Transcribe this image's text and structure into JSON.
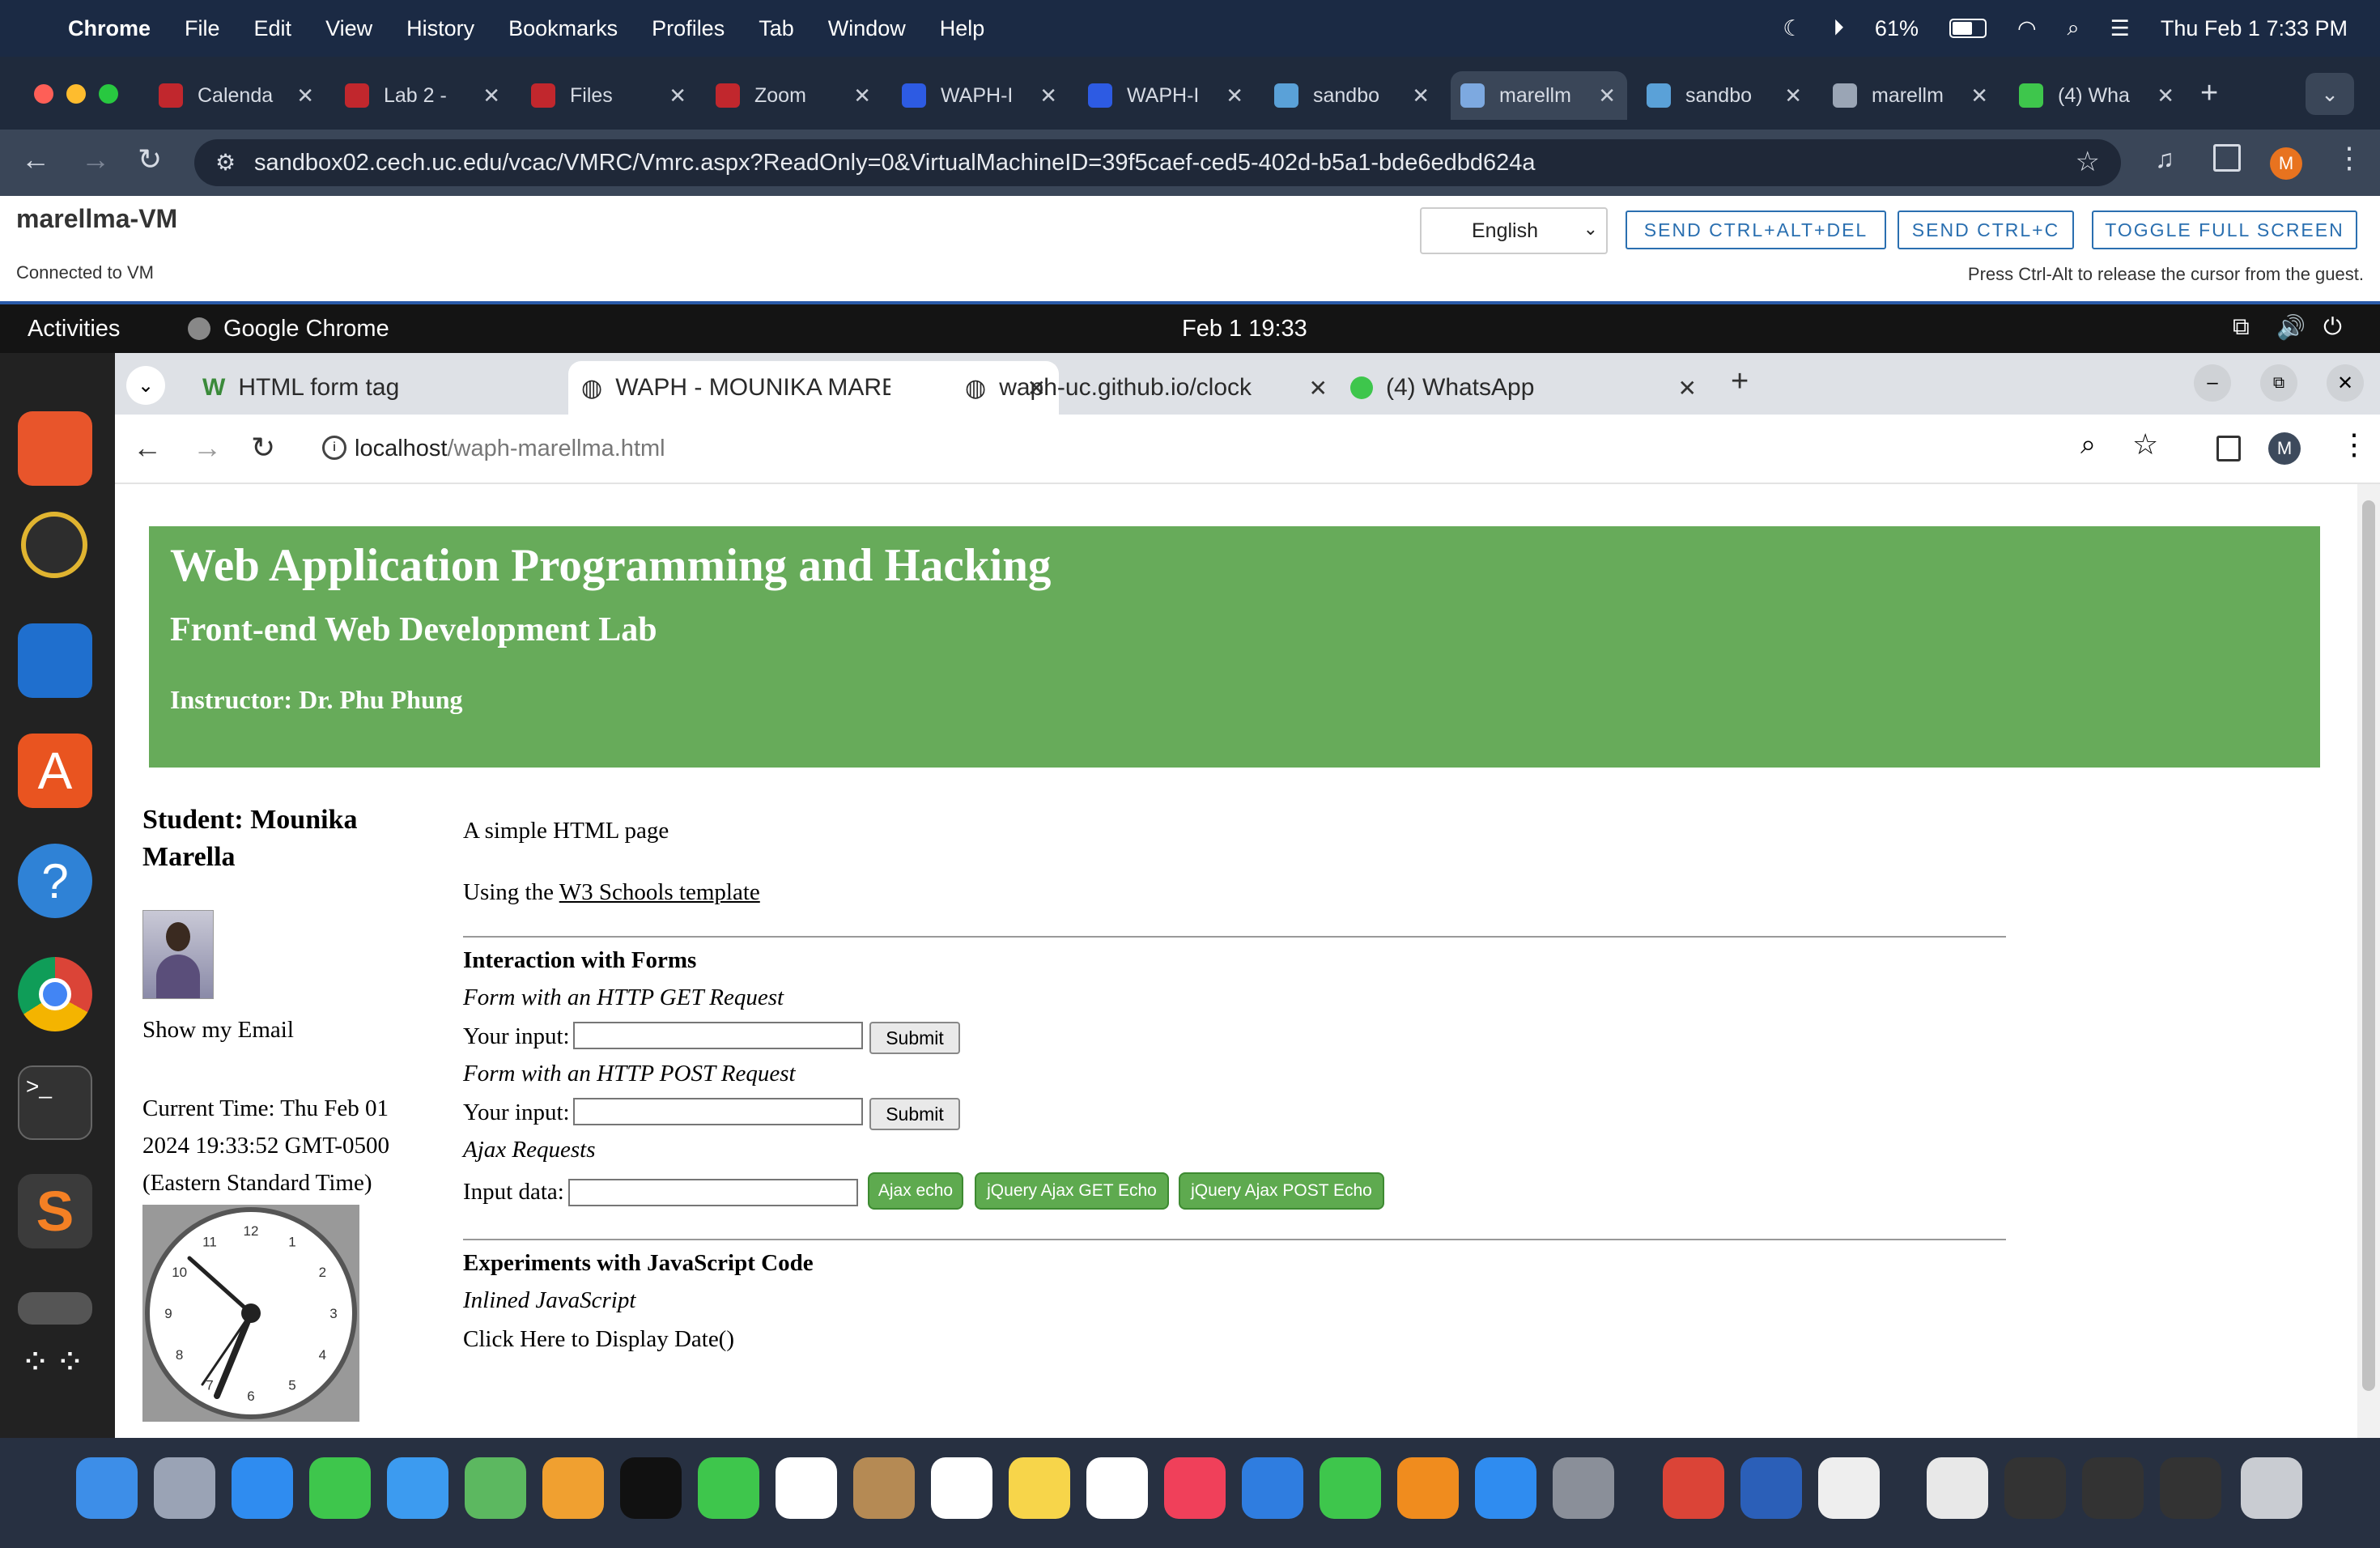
{
  "menubar": {
    "app": "Chrome",
    "items": [
      "File",
      "Edit",
      "View",
      "History",
      "Bookmarks",
      "Profiles",
      "Tab",
      "Window",
      "Help"
    ],
    "battery": "61%",
    "datetime": "Thu Feb 1  7:33 PM"
  },
  "outer_tabs": [
    {
      "label": "Calenda",
      "icon": "uc-icon",
      "color": "#c1272d"
    },
    {
      "label": "Lab 2 -",
      "icon": "uc-icon",
      "color": "#c1272d"
    },
    {
      "label": "Files",
      "icon": "uc-icon",
      "color": "#c1272d"
    },
    {
      "label": "Zoom",
      "icon": "uc-icon",
      "color": "#c1272d"
    },
    {
      "label": "WAPH-I",
      "icon": "zoom-icon",
      "color": "#2d5be3"
    },
    {
      "label": "WAPH-I",
      "icon": "zoom-icon",
      "color": "#2d5be3"
    },
    {
      "label": "sandbo",
      "icon": "globe-icon",
      "color": "#5aa1d8"
    },
    {
      "label": "marellm",
      "icon": "monitor-icon",
      "color": "#7da9e0"
    },
    {
      "label": "sandbo",
      "icon": "globe-icon",
      "color": "#5aa1d8"
    },
    {
      "label": "marellm",
      "icon": "globe-icon",
      "color": "#9aa5b5"
    },
    {
      "label": "(4) Wha",
      "icon": "whatsapp-icon",
      "color": "#3ec64c"
    }
  ],
  "outer_url": "sandbox02.cech.uc.edu/vcac/VMRC/Vmrc.aspx?ReadOnly=0&VirtualMachineID=39f5caef-ced5-402d-b5a1-bde6edbd624a",
  "profile_initial": "M",
  "vm": {
    "name": "marellma-VM",
    "status": "Connected to VM",
    "language": "English",
    "btn_cad": "SEND CTRL+ALT+DEL",
    "btn_cc": "SEND CTRL+C",
    "btn_fs": "TOGGLE FULL SCREEN",
    "hint": "Press Ctrl-Alt to release the cursor from the guest."
  },
  "ubuntu": {
    "activities": "Activities",
    "app": "Google Chrome",
    "clock": "Feb 1  19:33"
  },
  "inner_tabs": [
    {
      "label": "HTML form tag"
    },
    {
      "label": "WAPH - MOUNIKA MARE"
    },
    {
      "label": "waph-uc.github.io/clock"
    },
    {
      "label": "(4) WhatsApp"
    }
  ],
  "inner_url": {
    "host": "localhost",
    "path": "/waph-marellma.html"
  },
  "page": {
    "title": "Web Application Programming and Hacking",
    "subtitle": "Front-end Web Development Lab",
    "instructor": "Instructor: Dr. Phu Phung",
    "student": "Student: Mounika Marella",
    "show_email": "Show my Email",
    "time_text": "Current Time: Thu Feb 01 2024 19:33:52 GMT-0500 (Eastern Standard Time)",
    "simple": "A simple HTML page",
    "using": "Using the ",
    "w3_link": "W3 Schools template",
    "forms_heading": "Interaction with Forms",
    "get_heading": "Form with an HTTP GET Request",
    "your_input": "Your input:",
    "submit": "Submit",
    "post_heading": "Form with an HTTP POST Request",
    "ajax_heading": "Ajax Requests",
    "input_data": "Input data:",
    "ajax_echo": "Ajax echo",
    "jq_get": "jQuery Ajax GET Echo",
    "jq_post": "jQuery Ajax POST Echo",
    "js_heading": "Experiments with JavaScript Code",
    "inlined": "Inlined JavaScript",
    "click_here": "Click Here to Display Date()"
  },
  "clock_numbers": [
    "12",
    "1",
    "2",
    "3",
    "4",
    "5",
    "6",
    "7",
    "8",
    "9",
    "10",
    "11"
  ]
}
